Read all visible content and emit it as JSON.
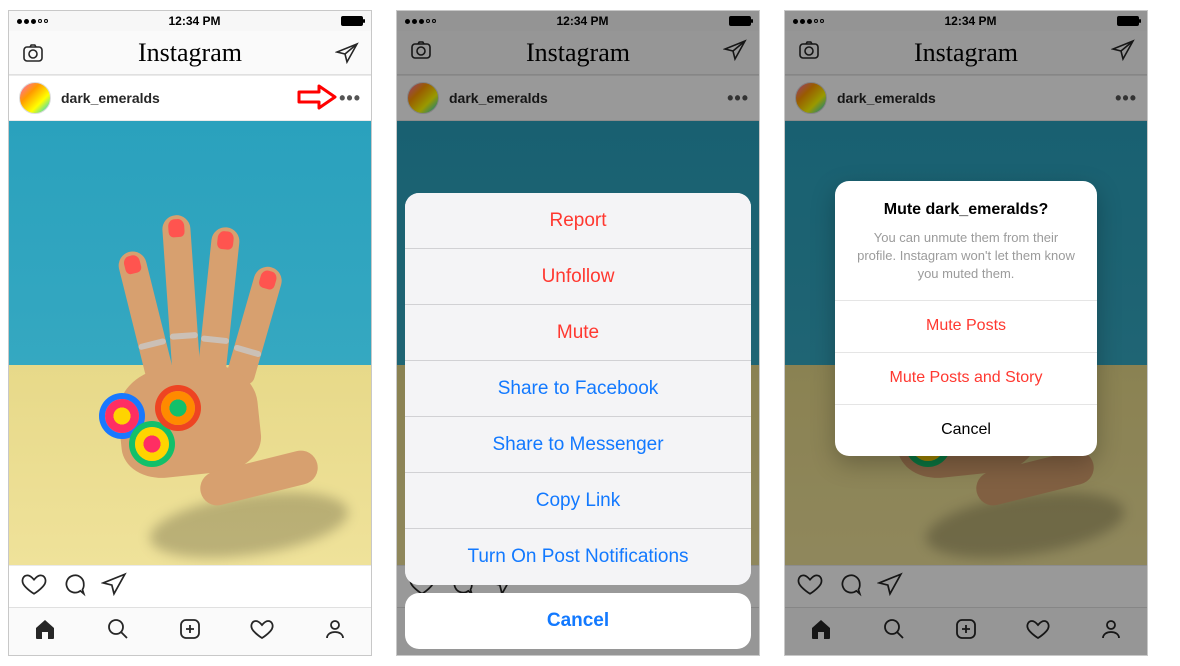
{
  "statusbar": {
    "time": "12:34 PM"
  },
  "header": {
    "logo": "Instagram"
  },
  "post": {
    "username": "dark_emeralds"
  },
  "screen1": {
    "has_arrow": true
  },
  "action_sheet": {
    "report": "Report",
    "unfollow": "Unfollow",
    "mute": "Mute",
    "share_facebook": "Share to Facebook",
    "share_messenger": "Share to Messenger",
    "copy_link": "Copy Link",
    "notifications": "Turn On Post Notifications",
    "cancel": "Cancel"
  },
  "mute_dialog": {
    "title": "Mute dark_emeralds?",
    "message": "You can unmute them from their profile. Instagram won't let them know you muted them.",
    "mute_posts": "Mute Posts",
    "mute_posts_story": "Mute Posts and Story",
    "cancel": "Cancel"
  }
}
